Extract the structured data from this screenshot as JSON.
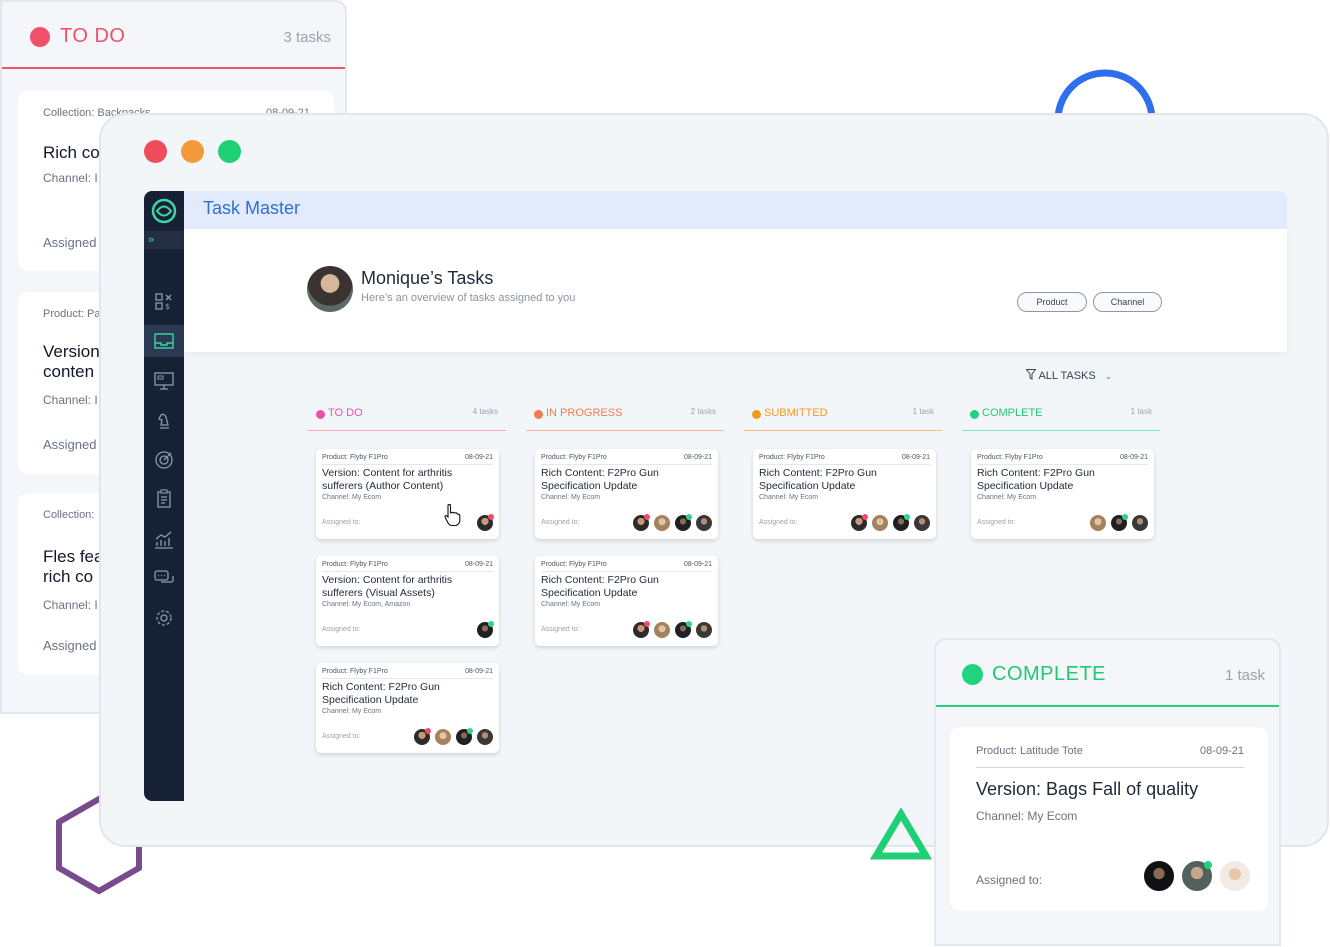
{
  "back_panel": {
    "title": "TO DO",
    "count": "3 tasks",
    "cards": [
      {
        "meta": "Collection: Backpacks",
        "date": "08-09-21",
        "title": "Rich co",
        "title2": "",
        "channel": "Channel: I",
        "assigned": "Assigned"
      },
      {
        "meta": "Product: Pa",
        "date": "",
        "title": "Version",
        "title2": "conten",
        "channel": "Channel: I",
        "assigned": "Assigned"
      },
      {
        "meta": "Collection:",
        "date": "",
        "title": "Fles fea",
        "title2": "rich co",
        "channel": "Channel: I",
        "assigned": "Assigned"
      }
    ]
  },
  "app": {
    "title": "Task Master",
    "profile": {
      "name": "Monique’s Tasks",
      "subtitle": "Here’s an overview of tasks assigned to you"
    },
    "pills": [
      "Product",
      "Channel"
    ],
    "filter": "ALL TASKS",
    "columns": [
      {
        "title": "TO DO",
        "count": "4 tasks",
        "color": "#f04fb0"
      },
      {
        "title": "IN PROGRESS",
        "count": "2 tasks",
        "color": "#f47b4f"
      },
      {
        "title": "SUBMITTED",
        "count": "1 task",
        "color": "#f39a1e"
      },
      {
        "title": "COMPLETE",
        "count": "1 task",
        "color": "#22d37d"
      }
    ],
    "cards": [
      {
        "product": "Product: Flyby F1Pro",
        "date": "08-09-21",
        "title": "Version: Content for arthritis sufferers (Author Content)",
        "channel": "Channel: My Ecom",
        "assigned": "Assigned to:"
      },
      {
        "product": "Product: Flyby F1Pro",
        "date": "08-09-21",
        "title": "Version: Content for arthritis sufferers (Visual Assets)",
        "channel": "Channel: My Ecom, Amazon",
        "assigned": "Assigned to:"
      },
      {
        "product": "Product: Flyby F1Pro",
        "date": "08-09-21",
        "title": "Rich Content: F2Pro Gun Specification Update",
        "channel": "Channel: My Ecom",
        "assigned": "Assigned to:"
      },
      {
        "product": "Product: Flyby F1Pro",
        "date": "08-09-21",
        "title": "Rich Content: F2Pro Gun Specification Update",
        "channel": "Channel: My Ecom",
        "assigned": "Assigned to:"
      },
      {
        "product": "Product: Flyby F1Pro",
        "date": "08-09-21",
        "title": "Rich Content: F2Pro Gun Specification Update",
        "channel": "Channel: My Ecom",
        "assigned": "Assigned to:"
      },
      {
        "product": "Product: Flyby F1Pro",
        "date": "08-09-21",
        "title": "Rich Content: F2Pro Gun Specification Update",
        "channel": "Channel: My Ecom",
        "assigned": "Assigned to:"
      },
      {
        "product": "Product: Flyby F1Pro",
        "date": "08-09-21",
        "title": "Rich Content: F2Pro Gun Specification Update",
        "channel": "Channel: My Ecom",
        "assigned": "Assigned to:"
      }
    ]
  },
  "complete_panel": {
    "title": "COMPLETE",
    "count": "1 task",
    "card": {
      "product": "Product: Latitude Tote",
      "date": "08-09-21",
      "title": "Version: Bags Fall of quality",
      "channel": "Channel: My Ecom",
      "assigned": "Assigned to:"
    }
  },
  "colors": {
    "red": "#f0506a",
    "orange": "#f59a3c",
    "green": "#22d37d",
    "blue": "#2f6fd6",
    "sidebar": "#172135"
  }
}
